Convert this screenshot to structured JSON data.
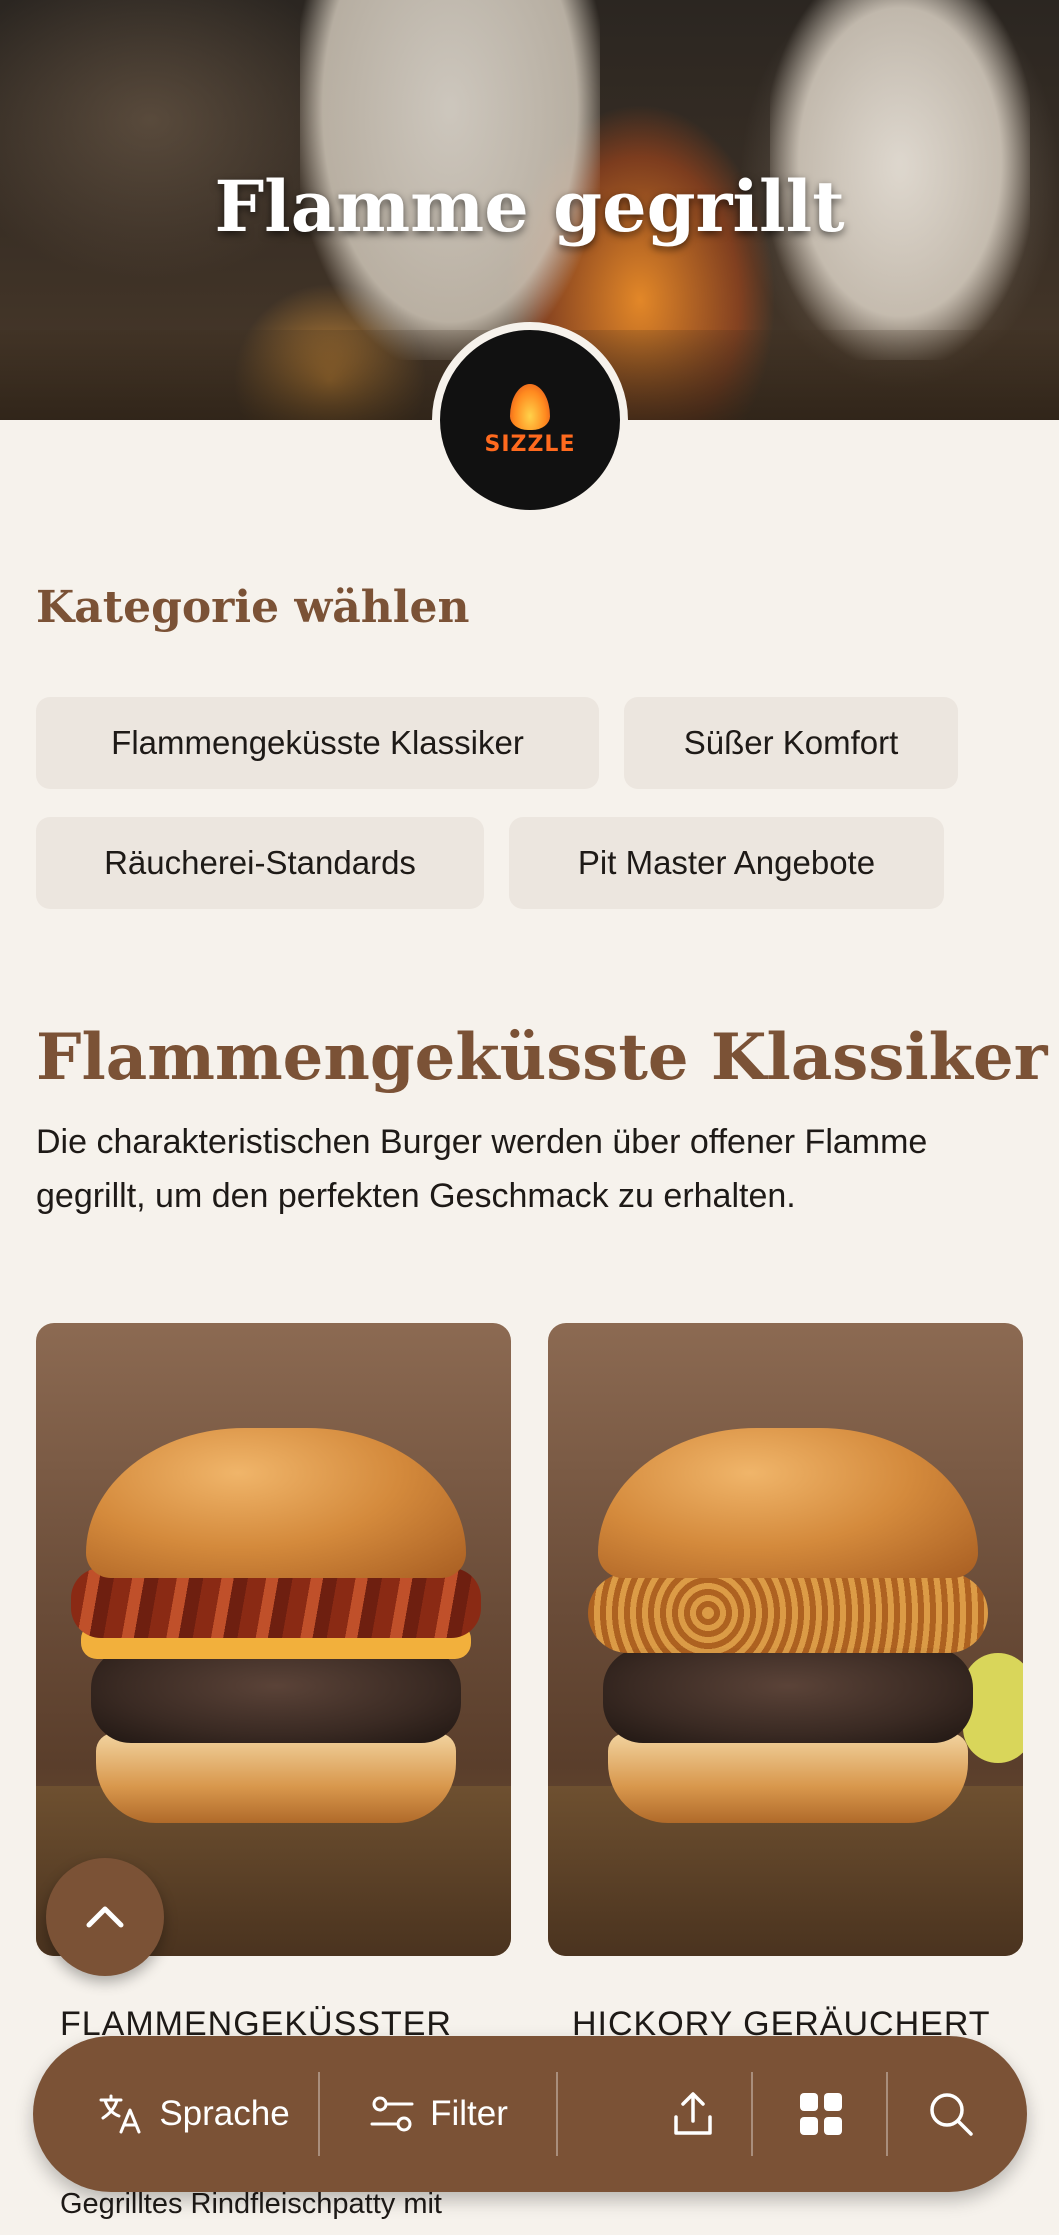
{
  "hero": {
    "title": "Flamme gegrillt",
    "logo_text": "SIZZLE"
  },
  "categories": {
    "heading": "Kategorie wählen",
    "items": [
      {
        "label": "Flammengeküsste Klassiker"
      },
      {
        "label": "Süßer Komfort"
      },
      {
        "label": "Räucherei-Standards"
      },
      {
        "label": "Pit Master Angebote"
      }
    ]
  },
  "section": {
    "title": "Flammengeküsste Klassiker",
    "description": "Die charakteristischen Burger werden über offener Flamme gegrillt, um den perfekten Geschmack zu erhalten."
  },
  "products": [
    {
      "name": "FLAMMENGEKÜSSTER",
      "description": "Gegrilltes Rindfleischpatty mit"
    },
    {
      "name": "HICKORY GERÄUCHERT",
      "description": ""
    }
  ],
  "bottom_bar": {
    "language_label": "Sprache",
    "filter_label": "Filter"
  },
  "icons": {
    "scroll_top": "chevron-up-icon",
    "language": "translate-icon",
    "filter": "filter-icon",
    "share": "share-icon",
    "grid": "grid-icon",
    "search": "search-icon"
  },
  "colors": {
    "accent": "#7b5236",
    "background": "#f6f2ec",
    "chip": "#ece6df"
  }
}
